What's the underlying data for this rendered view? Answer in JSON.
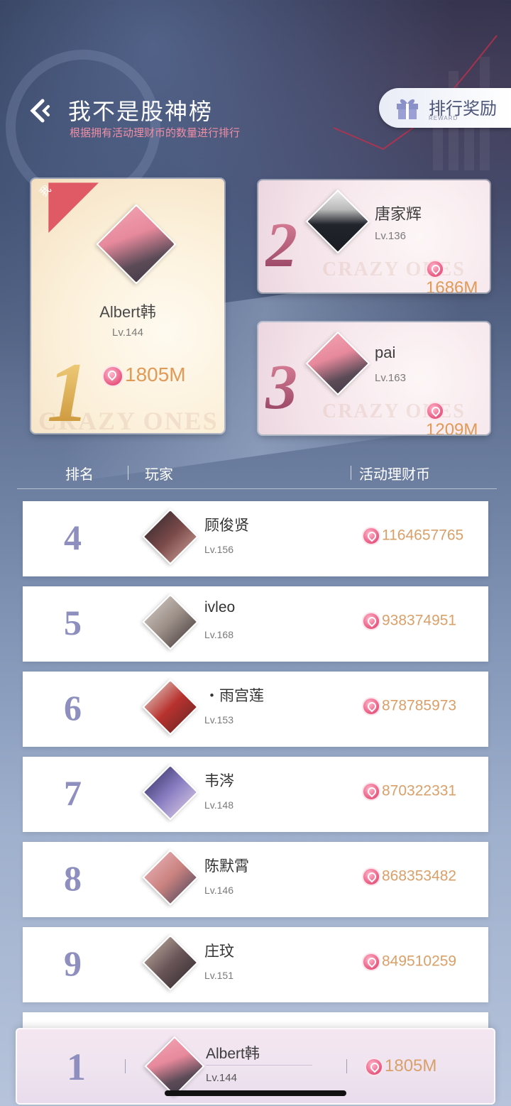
{
  "header": {
    "title": "我不是股神榜",
    "subtitle": "根据拥有活动理财币的数量进行排行",
    "reward_label": "排行奖励",
    "reward_sub": "REWARD"
  },
  "podium": [
    {
      "rank": "1",
      "name": "Albert韩",
      "level": "Lv.144",
      "coins": "1805M",
      "me_tag": "我",
      "watermark": "CRAZY ONES"
    },
    {
      "rank": "2",
      "name": "唐家辉",
      "level": "Lv.136",
      "coins": "1686M",
      "watermark": "CRAZY ONES"
    },
    {
      "rank": "3",
      "name": "pai",
      "level": "Lv.163",
      "coins": "1209M",
      "watermark": "CRAZY ONES"
    }
  ],
  "table_header": {
    "rank": "排名",
    "player": "玩家",
    "coins": "活动理财币"
  },
  "rows": [
    {
      "rank": "4",
      "name": "顾俊贤",
      "level": "Lv.156",
      "coins": "1164657765"
    },
    {
      "rank": "5",
      "name": "ivleo",
      "level": "Lv.168",
      "coins": "938374951"
    },
    {
      "rank": "6",
      "name": "・雨宫莲",
      "level": "Lv.153",
      "coins": "878785973"
    },
    {
      "rank": "7",
      "name": "韦涔",
      "level": "Lv.148",
      "coins": "870322331"
    },
    {
      "rank": "8",
      "name": "陈默霄",
      "level": "Lv.146",
      "coins": "868353482"
    },
    {
      "rank": "9",
      "name": "庄玟",
      "level": "Lv.151",
      "coins": "849510259"
    }
  ],
  "my_rank": {
    "rank": "1",
    "name": "Albert韩",
    "level": "Lv.144",
    "coins": "1805M"
  },
  "colors": {
    "accent_pink": "#f08ea4",
    "coin_gold": "#d9a06a",
    "rank_purple": "#8f8fbf"
  },
  "icons": [
    "back-arrow-icon",
    "gift-icon",
    "coin-icon",
    "avatar"
  ]
}
